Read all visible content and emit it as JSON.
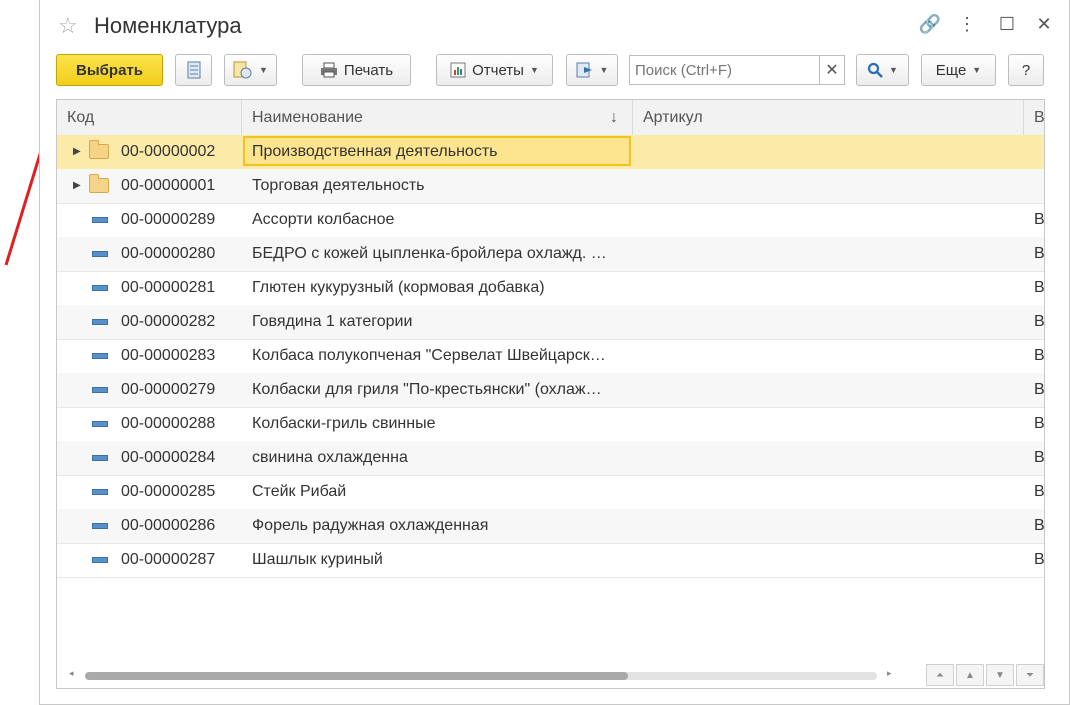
{
  "window": {
    "title": "Номенклатура"
  },
  "toolbar": {
    "select_label": "Выбрать",
    "print_label": "Печать",
    "reports_label": "Отчеты",
    "search_placeholder": "Поиск (Ctrl+F)",
    "more_label": "Еще",
    "help_label": "?"
  },
  "grid": {
    "columns": [
      "Код",
      "Наименование",
      "Артикул",
      "В"
    ],
    "sort_indicator": "↓",
    "selected_row_index": 0,
    "rows": [
      {
        "type": "folder",
        "code": "00-00000002",
        "name": "Производственная деятельность",
        "article": "",
        "v": ""
      },
      {
        "type": "folder",
        "code": "00-00000001",
        "name": "Торговая деятельность",
        "article": "",
        "v": ""
      },
      {
        "type": "item",
        "code": "00-00000289",
        "name": "Ассорти колбасное",
        "article": "",
        "v": "В"
      },
      {
        "type": "item",
        "code": "00-00000280",
        "name": "БЕДРО с кожей цыпленка-бройлера охлажд. …",
        "article": "",
        "v": "В"
      },
      {
        "type": "item",
        "code": "00-00000281",
        "name": "Глютен кукурузный (кормовая добавка)",
        "article": "",
        "v": "В"
      },
      {
        "type": "item",
        "code": "00-00000282",
        "name": "Говядина 1 категории",
        "article": "",
        "v": "В"
      },
      {
        "type": "item",
        "code": "00-00000283",
        "name": "Колбаса полукопченая \"Сервелат Швейцарск…",
        "article": "",
        "v": "В"
      },
      {
        "type": "item",
        "code": "00-00000279",
        "name": "Колбаски для гриля \"По-крестьянски\" (охлаж…",
        "article": "",
        "v": "В"
      },
      {
        "type": "item",
        "code": "00-00000288",
        "name": "Колбаски-гриль свинные",
        "article": "",
        "v": "В"
      },
      {
        "type": "item",
        "code": "00-00000284",
        "name": "свинина охлажденна",
        "article": "",
        "v": "В"
      },
      {
        "type": "item",
        "code": "00-00000285",
        "name": "Стейк Рибай",
        "article": "",
        "v": "В"
      },
      {
        "type": "item",
        "code": "00-00000286",
        "name": "Форель радужная охлажденная",
        "article": "",
        "v": "В"
      },
      {
        "type": "item",
        "code": "00-00000287",
        "name": "Шашлык куриный",
        "article": "",
        "v": "В"
      }
    ]
  },
  "colors": {
    "accent": "#f2cc1b",
    "selection": "#fbeaa8",
    "annotation_arrow": "#e02020"
  }
}
